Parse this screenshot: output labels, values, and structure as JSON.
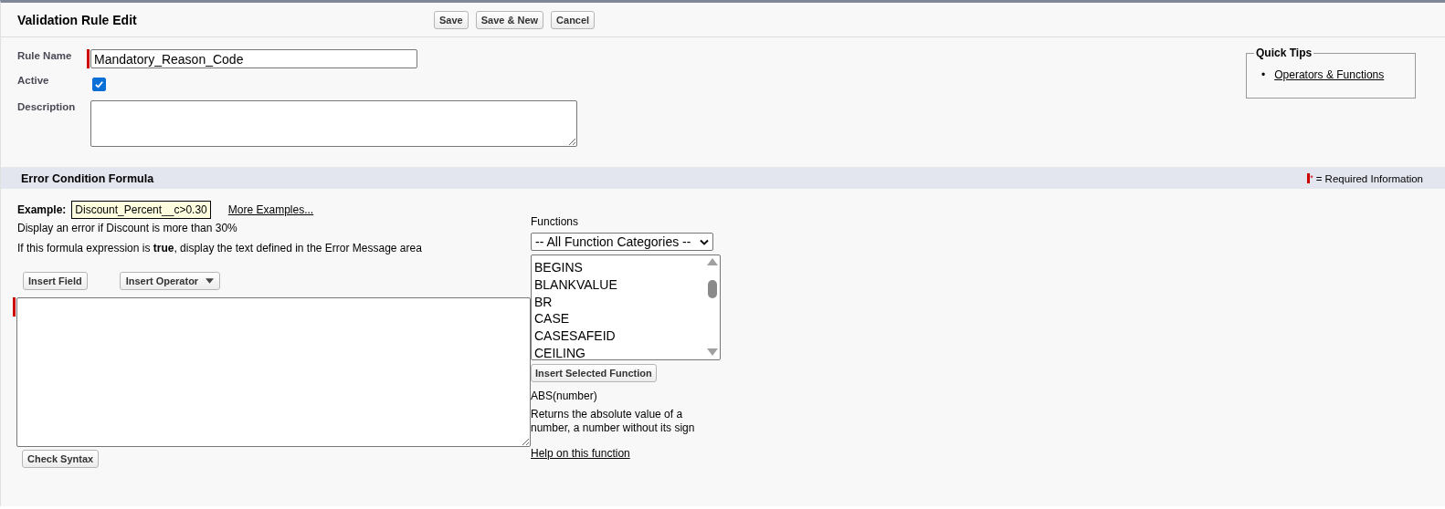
{
  "header": {
    "title": "Validation Rule Edit",
    "buttons": [
      "Save",
      "Save & New",
      "Cancel"
    ]
  },
  "fields": {
    "rule_name": {
      "label": "Rule Name",
      "value": "Mandatory_Reason_Code",
      "required": true
    },
    "active": {
      "label": "Active",
      "checked": true
    },
    "description": {
      "label": "Description"
    }
  },
  "quick_tips": {
    "title": "Quick Tips",
    "links": [
      {
        "bullet": "•",
        "label": "Operators & Functions"
      }
    ]
  },
  "section": {
    "title": "Error Condition Formula",
    "legend_mark": "*",
    "legend": "= Required Information"
  },
  "example": {
    "label": "Example:",
    "code": "Discount_Percent__c>0.30",
    "link": "More Examples...",
    "note": "Display an error if Discount is more than 30%",
    "instruction": "If this formula expression is **true**, display the text defined in the Error Message area"
  },
  "formula": {
    "insert_field": "Insert Field",
    "insert_operator": "Insert Operator",
    "required": true,
    "check_syntax": "Check Syntax"
  },
  "functions": {
    "label": "Functions",
    "category": "-- All Function Categories --",
    "items": [
      "BEGINS",
      "BLANKVALUE",
      "BR",
      "CASE",
      "CASESAFEID",
      "CEILING"
    ],
    "insert_button": "Insert Selected Function",
    "signature": "ABS(number)",
    "description": "Returns the absolute value of a number, a number without its sign",
    "help_link": "Help on this function"
  }
}
